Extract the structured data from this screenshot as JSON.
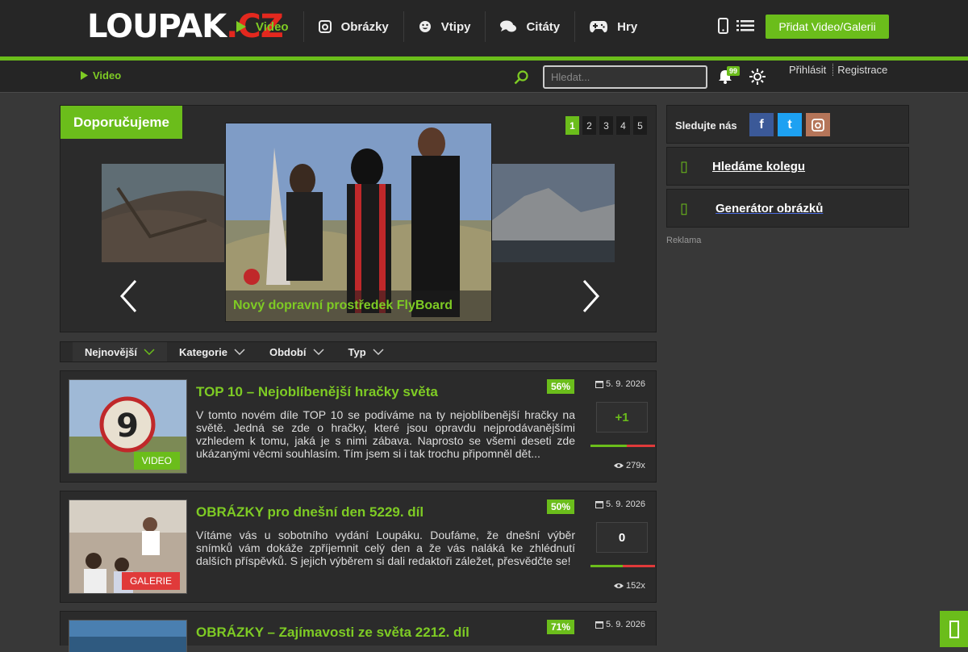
{
  "header": {
    "logo_main": "LOUPAK",
    "logo_tld": ".CZ",
    "nav": [
      {
        "label": "Video",
        "icon": "play-icon"
      },
      {
        "label": "Obrázky",
        "icon": "instagram-icon"
      },
      {
        "label": "Vtipy",
        "icon": "smiley-icon"
      },
      {
        "label": "Citáty",
        "icon": "comments-icon"
      },
      {
        "label": "Hry",
        "icon": "gamepad-icon"
      }
    ],
    "add_button": "Přidat Video/Galerii"
  },
  "subbar": {
    "breadcrumb": "Video",
    "search_placeholder": "Hledat...",
    "notifications": "99",
    "login": "Přihlásit",
    "register": "Registrace"
  },
  "featured": {
    "title": "Doporučujeme",
    "pages": [
      "1",
      "2",
      "3",
      "4",
      "5"
    ],
    "active_page": "1",
    "caption": "Nový dopravní prostředek FlyBoard"
  },
  "filters": [
    "Nejnovější",
    "Kategorie",
    "Období",
    "Typ"
  ],
  "articles": [
    {
      "title": "TOP 10 – Nejoblíbenější hračky světa",
      "percent": "56%",
      "date": "5. 9. 2026",
      "votes": "+1",
      "views": "279x",
      "tag": "VIDEO",
      "description": "V tomto novém díle TOP 10 se podíváme na ty nejoblíbenější hračky na světě. Jedná se zde o hračky, které jsou opravdu nejprodávanějšími vzhledem k tomu, jaká je s nimi zábava. Naprosto se všemi deseti zde ukázanými věcmi souhlasím. Tím jsem si i tak trochu připomněl dět..."
    },
    {
      "title": "OBRÁZKY pro dnešní den 5229. díl",
      "percent": "50%",
      "date": "5. 9. 2026",
      "votes": "0",
      "views": "152x",
      "tag": "GALERIE",
      "description": "Vítáme vás u sobotního vydání Loupáku. Doufáme, že dnešní výběr snímků vám dokáže zpříjemnit celý den a že vás naláká ke zhlédnutí dalších příspěvků. S jejich výběrem si dali redaktoři záležet, přesvědčte se!"
    },
    {
      "title": "OBRÁZKY – Zajímavosti ze světa 2212. díl",
      "percent": "71%",
      "date": "5. 9. 2026"
    }
  ],
  "sidebar": {
    "follow_label": "Sledujte nás",
    "social": [
      "f",
      "t"
    ],
    "box1": "Hledáme kolegu",
    "box2": "Generátor obrázků",
    "ad_label": "Reklama"
  },
  "colors": {
    "accent": "#6bbd1b",
    "galerie": "#e03a3a"
  }
}
